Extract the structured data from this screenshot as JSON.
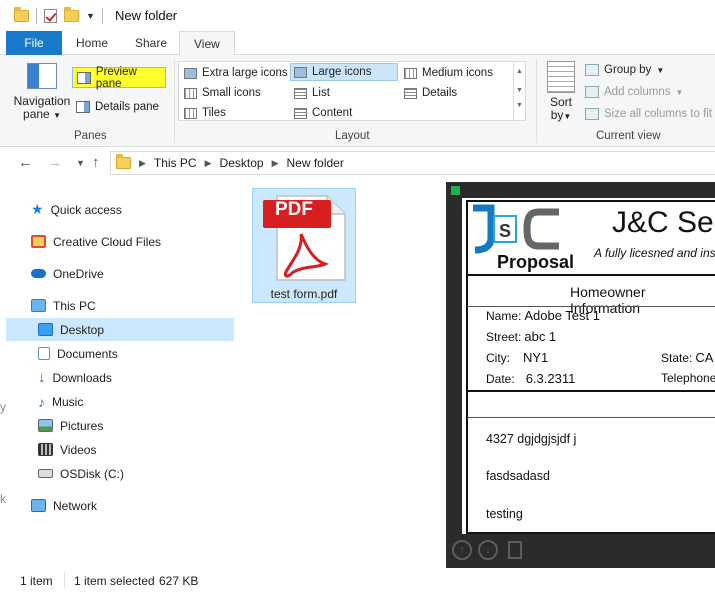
{
  "window": {
    "title": "New folder"
  },
  "ribbon": {
    "tabs": [
      "File",
      "Home",
      "Share",
      "View"
    ],
    "panes": {
      "navigation_pane_line1": "Navigation",
      "navigation_pane_line2": "pane",
      "preview_pane": "Preview pane",
      "details_pane": "Details pane",
      "group_label": "Panes"
    },
    "layout": {
      "items": [
        "Extra large icons",
        "Large icons",
        "Medium icons",
        "Small icons",
        "List",
        "Details",
        "Tiles",
        "Content"
      ],
      "selected": "Large icons",
      "group_label": "Layout"
    },
    "current_view": {
      "sort_line1": "Sort",
      "sort_line2": "by",
      "group_by": "Group by",
      "add_columns": "Add columns",
      "size_all_columns": "Size all columns to fit",
      "group_label": "Current view"
    },
    "highlight_color": "#ffff2b",
    "file_tab_color": "#1979ca"
  },
  "address_bar": {
    "crumbs": [
      "This PC",
      "Desktop",
      "New folder"
    ]
  },
  "sidebar": {
    "items": [
      {
        "label": "Quick access",
        "icon": "star-icon"
      },
      {
        "label": "Creative Cloud Files",
        "icon": "creative-cloud-icon"
      },
      {
        "label": "OneDrive",
        "icon": "cloud-icon"
      },
      {
        "label": "This PC",
        "icon": "computer-icon"
      },
      {
        "label": "Desktop",
        "icon": "desktop-icon",
        "selected": true
      },
      {
        "label": "Documents",
        "icon": "documents-icon"
      },
      {
        "label": "Downloads",
        "icon": "downloads-icon"
      },
      {
        "label": "Music",
        "icon": "music-icon"
      },
      {
        "label": "Pictures",
        "icon": "pictures-icon"
      },
      {
        "label": "Videos",
        "icon": "videos-icon"
      },
      {
        "label": "OSDisk (C:)",
        "icon": "disk-icon"
      },
      {
        "label": "Network",
        "icon": "network-icon"
      }
    ],
    "selected_color": "#cce8ff"
  },
  "files": [
    {
      "name": "test form.pdf",
      "icon_label": "PDF"
    }
  ],
  "preview": {
    "company": "J&C Serv",
    "tagline": "A fully licesned and insure",
    "logo_letters": "J S C",
    "proposal": "Proposal",
    "section_title": "Homeowner Information",
    "fields": {
      "name_label": "Name:",
      "name_value": "Adobe Test 1",
      "street_label": "Street:",
      "street_value": "abc 1",
      "city_label": "City:",
      "city_value": "NY1",
      "state_label": "State:",
      "state_value": "CA",
      "date_label": "Date:",
      "date_value": "6.3.2311",
      "telephone_label": "Telephone:"
    },
    "notes": [
      "4327 dgjdgjsjdf j",
      "fasdsadasd",
      "testing"
    ]
  },
  "status_bar": {
    "item_count": "1 item",
    "selection": "1 item selected",
    "size": "627 KB"
  }
}
